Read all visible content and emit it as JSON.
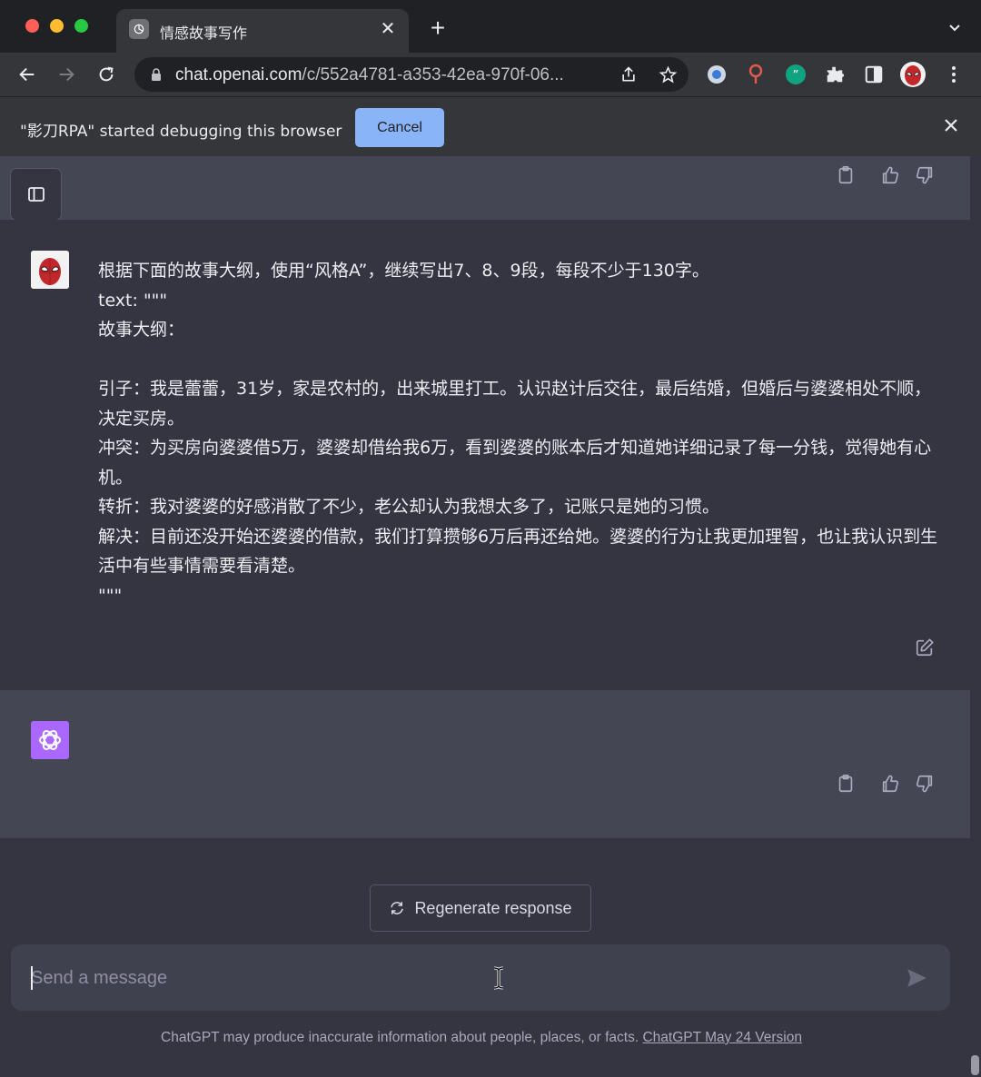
{
  "browser": {
    "tab_title": "情感故事写作",
    "url_host": "chat.openai.com",
    "url_path": "/c/552a4781-a353-42ea-970f-06...",
    "icons": [
      "back-icon",
      "forward-icon",
      "reload-icon",
      "lock-icon",
      "share-icon",
      "bookmark-star-icon",
      "extension-circle-icon",
      "extension-pin-icon",
      "extension-quote-icon",
      "puzzle-icon",
      "sidepanel-icon",
      "profile-avatar",
      "kebab-menu-icon"
    ]
  },
  "debug_bar": {
    "message": "\"影刀RPA\" started debugging this browser",
    "cancel_label": "Cancel"
  },
  "conversation": {
    "user_message": {
      "lines": [
        "根据下面的故事大纲，使用“风格A”，继续写出7、8、9段，每段不少于130字。",
        "text: \"\"\"",
        "故事大纲：",
        "",
        "引子：我是蕾蕾，31岁，家是农村的，出来城里打工。认识赵计后交往，最后结婚，但婚后与婆婆相处不顺，决定买房。",
        "冲突：为买房向婆婆借5万，婆婆却借给我6万，看到婆婆的账本后才知道她详细记录了每一分钱，觉得她有心机。",
        "转折：我对婆婆的好感消散了不少，老公却认为我想太多了，记账只是她的习惯。",
        "解决：目前还没开始还婆婆的借款，我们打算攒够6万后再还给她。婆婆的行为让我更加理智，也让我认识到生活中有些事情需要看清楚。",
        "\"\"\""
      ]
    },
    "assistant_message": {
      "text": ""
    }
  },
  "regenerate_label": "Regenerate response",
  "composer": {
    "placeholder": "Send a message"
  },
  "footer": {
    "text": "ChatGPT may produce inaccurate information about people, places, or facts. ",
    "link": "ChatGPT May 24 Version"
  },
  "colors": {
    "page_bg": "#343541",
    "assistant_bg": "#444654",
    "input_bg": "#40414f",
    "cancel_button": "#8ab4f8",
    "bot_avatar": "#ab68ff"
  }
}
